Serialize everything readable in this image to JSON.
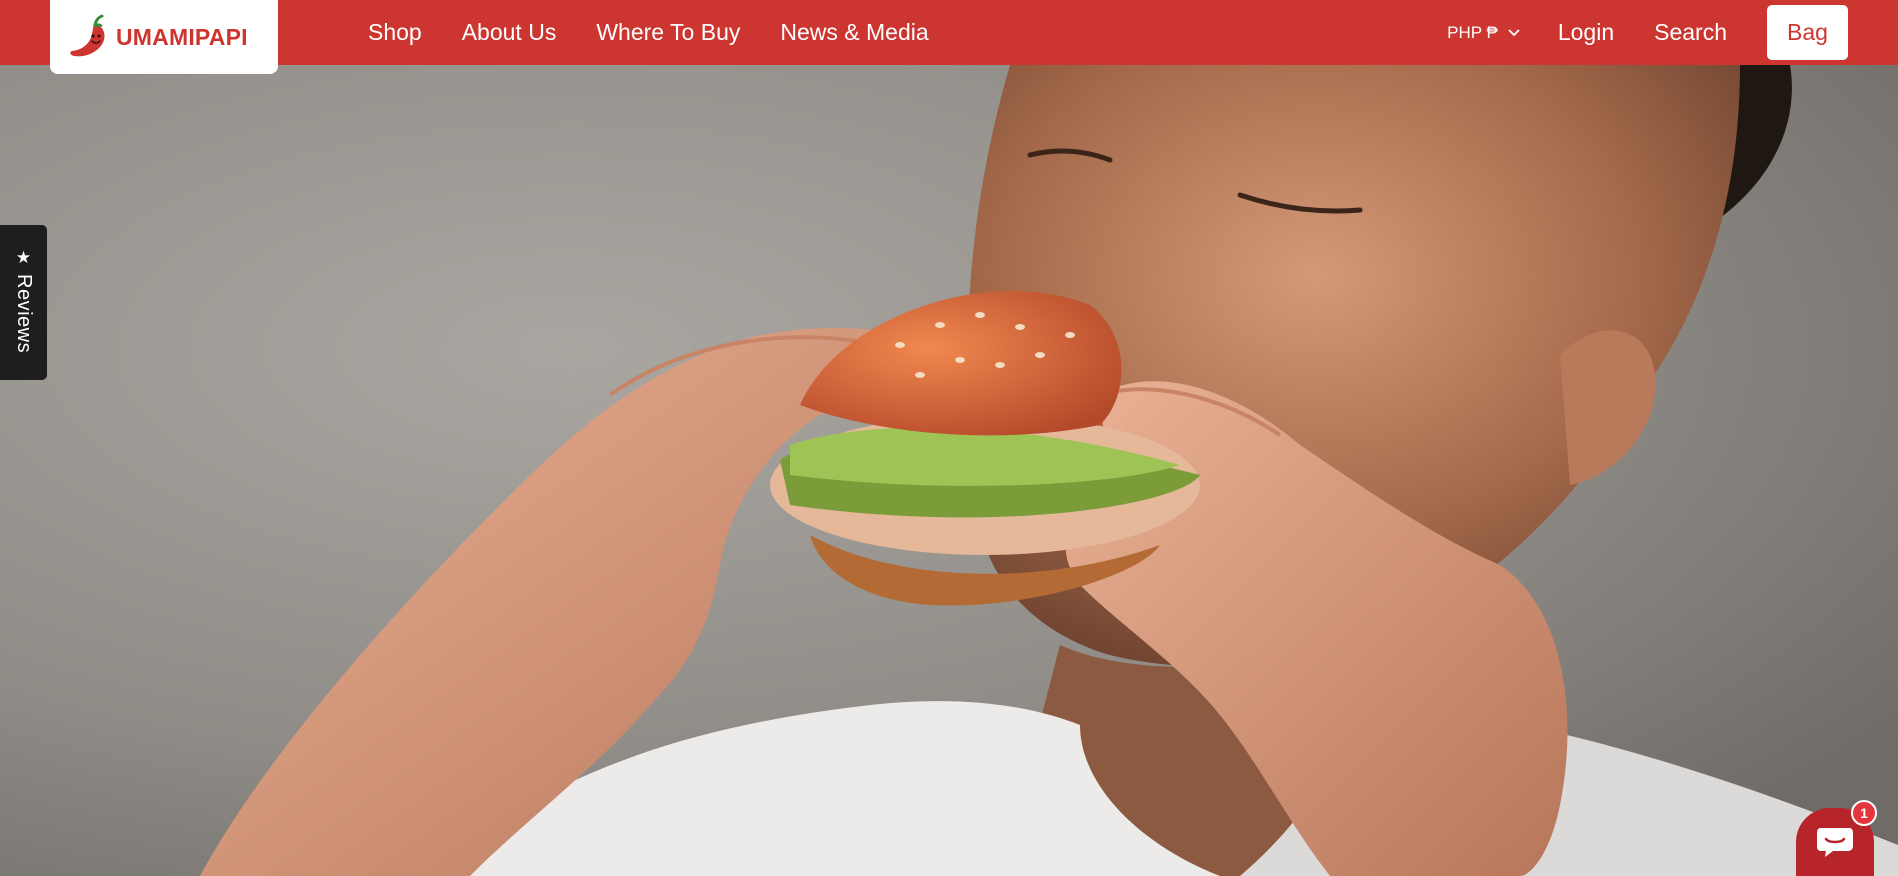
{
  "brand": {
    "name": "UMAMIPAPI"
  },
  "nav": {
    "items": [
      {
        "label": "Shop"
      },
      {
        "label": "About Us"
      },
      {
        "label": "Where To Buy"
      },
      {
        "label": "News & Media"
      }
    ]
  },
  "header_right": {
    "currency": "PHP ₱",
    "login": "Login",
    "search": "Search",
    "bag": "Bag"
  },
  "reviews_tab": {
    "label": "Reviews",
    "icon": "star-icon"
  },
  "chat": {
    "icon": "chat-bubble-icon",
    "badge_count": "1"
  },
  "colors": {
    "brand_red": "#cd3530",
    "reviews_tab": "#1e1e1e",
    "chat_button": "#b7242a",
    "badge": "#e4343e"
  },
  "hero": {
    "image": "man-eating-burger-photo"
  }
}
